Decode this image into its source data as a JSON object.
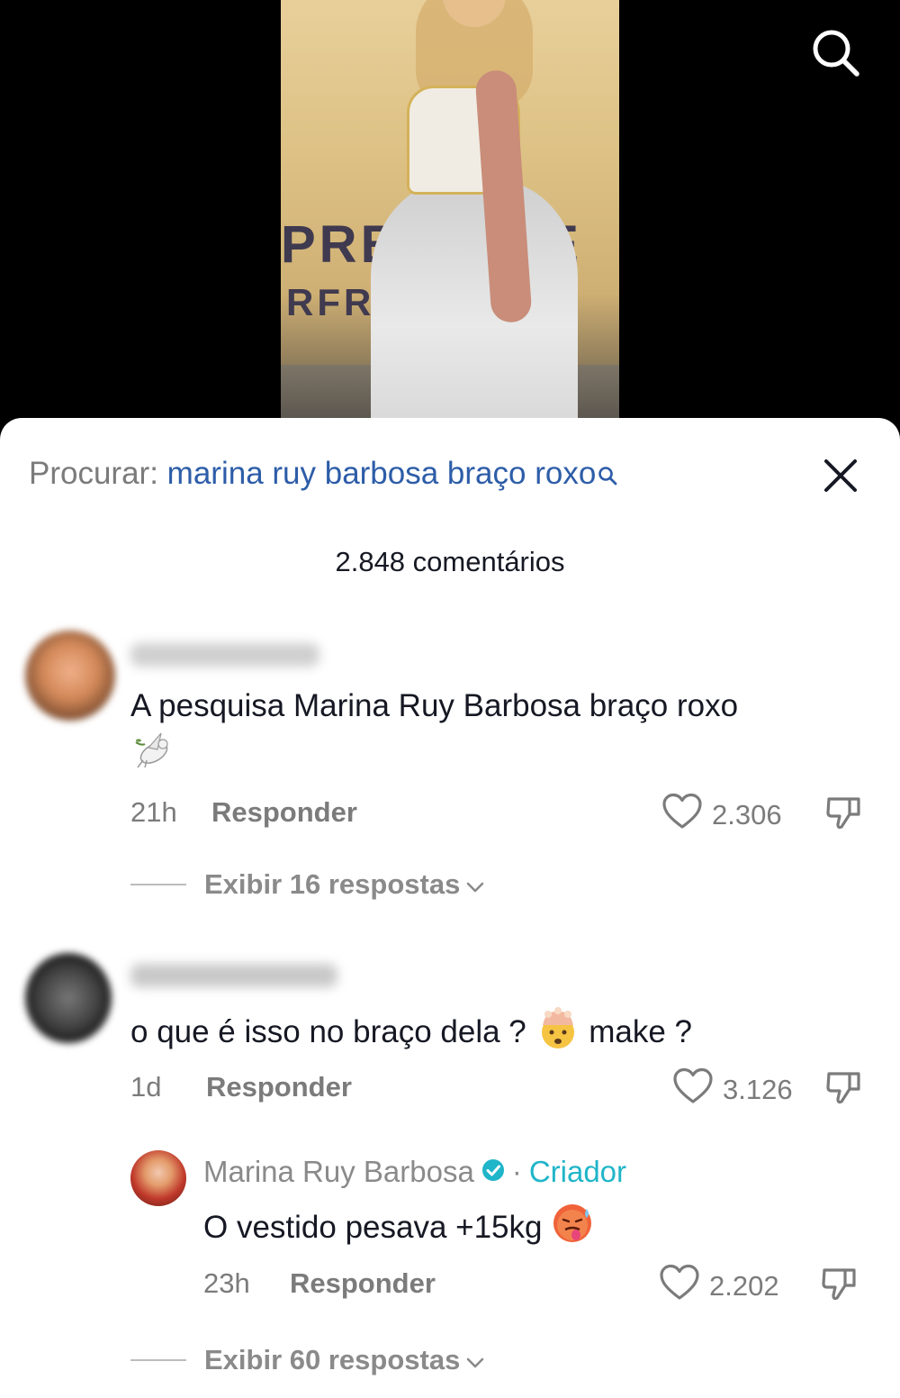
{
  "video": {
    "backdrop_line1": "PREMIERE",
    "backdrop_line2": "RFRA"
  },
  "sheet": {
    "search_prefix": "Procurar:",
    "search_query": "marina ruy barbosa braço roxo",
    "comment_count": "2.848 comentários"
  },
  "comments": [
    {
      "text": "A pesquisa Marina Ruy Barbosa braço roxo",
      "emoji": "dove",
      "time": "21h",
      "reply_label": "Responder",
      "likes": "2.306",
      "view_replies": "Exibir 16 respostas"
    },
    {
      "text_before": "o que é isso no braço dela ?",
      "emoji": "exploding-head",
      "text_after": "make ?",
      "time": "1d",
      "reply_label": "Responder",
      "likes": "3.126",
      "reply": {
        "author": "Marina Ruy Barbosa",
        "separator": "·",
        "tag": "Criador",
        "text": "O vestido pesava +15kg",
        "emoji": "hot-face",
        "time": "23h",
        "reply_label": "Responder",
        "likes": "2.202"
      },
      "view_replies": "Exibir 60 respostas"
    }
  ],
  "colors": {
    "query": "#2d5da8",
    "creator": "#20b5c9",
    "muted": "#7b7b7b",
    "text": "#161823"
  }
}
